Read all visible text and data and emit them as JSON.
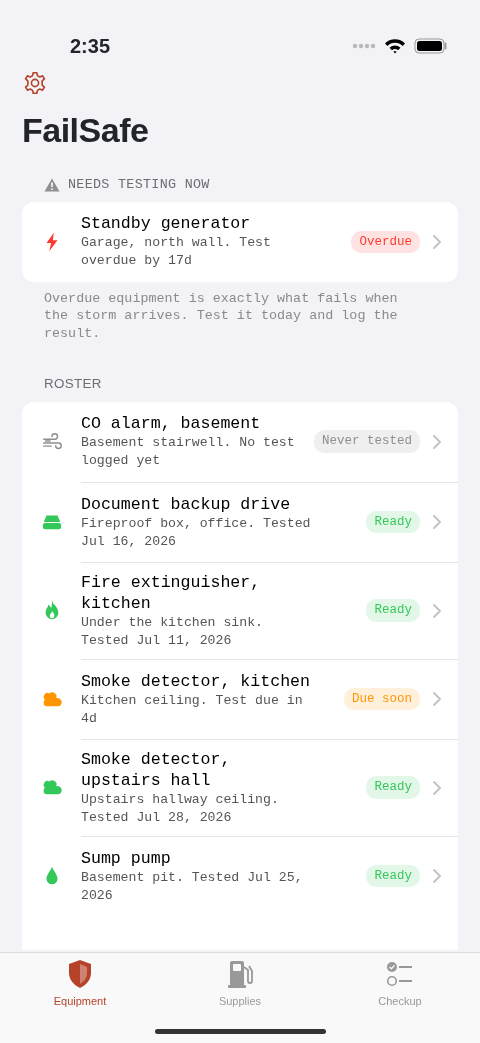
{
  "status_bar": {
    "time": "2:35"
  },
  "title": "FailSafe",
  "needs_testing": {
    "header": "NEEDS TESTING NOW",
    "items": [
      {
        "kind": "bolt",
        "name": "Standby generator",
        "detail": "Garage, north wall. Test overdue by 17d",
        "color": "#ff3b30",
        "badge": "Overdue"
      }
    ],
    "footer": "Overdue equipment is exactly what fails when the storm arrives. Test it today and log the result."
  },
  "roster": {
    "header": "ROSTER",
    "items": [
      {
        "kind": "wind",
        "name": "CO alarm, basement",
        "detail": "Basement stairwell. No test logged yet",
        "color": "#8e8e93",
        "badge": "Never tested"
      },
      {
        "kind": "drive",
        "name": "Document backup drive",
        "detail": "Fireproof box, office. Tested Jul 16, 2026",
        "color": "#34c759",
        "badge": "Ready"
      },
      {
        "kind": "flame",
        "name": "Fire extinguisher, kitchen",
        "detail": "Under the kitchen sink. Tested Jul 11, 2026",
        "color": "#34c759",
        "badge": "Ready"
      },
      {
        "kind": "cloud",
        "name": "Smoke detector, kitchen",
        "detail": "Kitchen ceiling. Test due in 4d",
        "color": "#ff9500",
        "badge": "Due soon"
      },
      {
        "kind": "cloud",
        "name": "Smoke detector, upstairs hall",
        "detail": "Upstairs hallway ceiling. Tested Jul 28, 2026",
        "color": "#34c759",
        "badge": "Ready"
      },
      {
        "kind": "drop",
        "name": "Sump pump",
        "detail": "Basement pit. Tested Jul 25, 2026",
        "color": "#34c759",
        "badge": "Ready"
      }
    ]
  },
  "tab_bar": [
    {
      "kind": "shield",
      "label": "Equipment",
      "selected": true
    },
    {
      "kind": "fuel",
      "label": "Supplies",
      "selected": false
    },
    {
      "kind": "checklist",
      "label": "Checkup",
      "selected": false
    }
  ]
}
